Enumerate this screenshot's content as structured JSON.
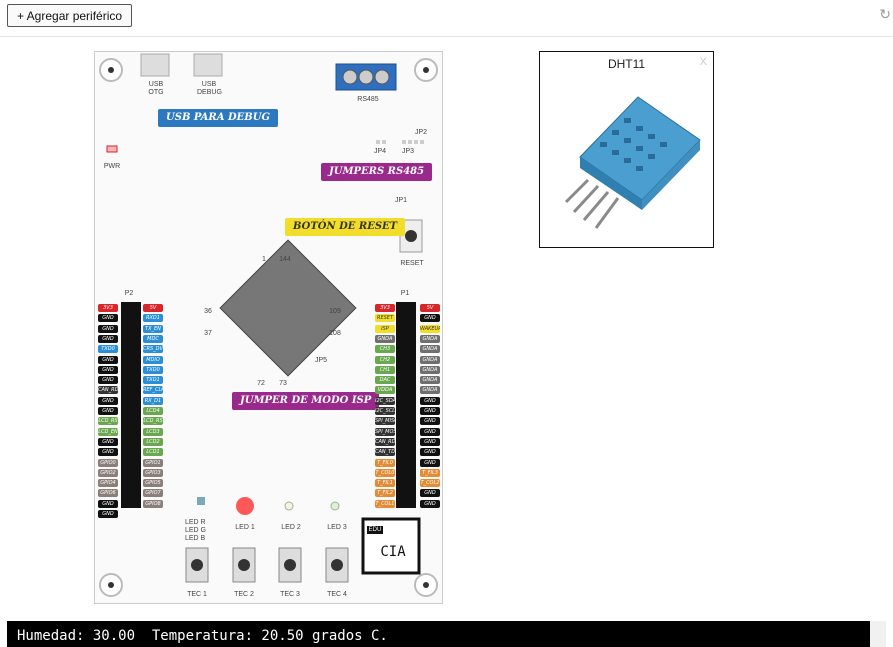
{
  "toolbar": {
    "add_label": "+ Agregar periférico",
    "refresh_icon": "refresh-icon"
  },
  "board": {
    "usb_otg": "USB\nOTG",
    "usb_debug": "USB\nDEBUG",
    "rs485": "RS485",
    "tag_usb": "USB PARA DEBUG",
    "tag_jumpers": "JUMPERS RS485",
    "tag_reset": "BOTÓN DE RESET",
    "tag_isp": "JUMPER DE MODO ISP",
    "pwr": "PWR",
    "jp1": "JP1",
    "jp2": "JP2",
    "jp3": "JP3",
    "jp4": "JP4",
    "jp5": "JP5",
    "reset": "RESET",
    "p1": "P1",
    "p2": "P2",
    "chip_pins": {
      "p1": "1",
      "p144": "144",
      "p36": "36",
      "p37": "37",
      "p72": "72",
      "p73": "73",
      "p108": "108",
      "p109": "109"
    },
    "led_rgb": "LED R\nLED G\nLED B",
    "led1": "LED 1",
    "led2": "LED 2",
    "led3": "LED 3",
    "tec1": "TEC 1",
    "tec2": "TEC 2",
    "tec3": "TEC 3",
    "tec4": "TEC 4",
    "edu": "EDU",
    "ciaa": "CIA",
    "colors": {
      "red": "#d9262b",
      "blue": "#2a8fd6",
      "black": "#111111",
      "green": "#6aa84f",
      "gray": "#6f6f6f",
      "yellow": "#f3dd2b",
      "orange": "#e38b35",
      "purple": "#992a8c",
      "tagblue": "#2c79c0"
    }
  },
  "p2_left": [
    "3V3",
    "GND",
    "GND",
    "GND",
    "TXD0",
    "GND",
    "GND",
    "GND",
    "CAN_RD",
    "GND",
    "GND",
    "LCD_RS",
    "LCD_EN",
    "GND",
    "GND",
    "GPIO0",
    "GPIO2",
    "GPIO4",
    "GPIO6",
    "GND",
    "GND"
  ],
  "p2_right": [
    "5V",
    "RXD1",
    "TX_EN",
    "MDC",
    "CRS_DV",
    "MDIO",
    "TXD0",
    "TXD1",
    "REF_CLK",
    "RX_D1",
    "LCD4",
    "LCD_RS",
    "LCD3",
    "LCD2",
    "LCD1",
    "GPIO1",
    "GPIO3",
    "GPIO5",
    "GPIO7",
    "GPIO8"
  ],
  "p1_left": [
    "3V3",
    "RESET",
    "ISP",
    "GNDA",
    "CH3",
    "CH2",
    "CH1",
    "DAC",
    "VDDA",
    "I2C_SDA",
    "I2C_SCL",
    "SPI_MISO",
    "SPI_MOSI",
    "CAN_RD",
    "CAN_TD",
    "T_FIL0",
    "T_COL0",
    "T_FIL1",
    "T_FIL2",
    "T_COL1"
  ],
  "p1_right": [
    "5V",
    "GND",
    "WAKEUP",
    "GNDA",
    "GNDA",
    "GNDA",
    "GNDA",
    "GNDA",
    "GNDA",
    "GND",
    "GND",
    "GND",
    "GND",
    "GND",
    "GND",
    "GND",
    "T_FIL3",
    "T_COL2",
    "GND",
    "GND"
  ],
  "sensor": {
    "title": "DHT11",
    "close": "X"
  },
  "console": {
    "text": "Humedad: 30.00  Temperatura: 20.50 grados C."
  }
}
